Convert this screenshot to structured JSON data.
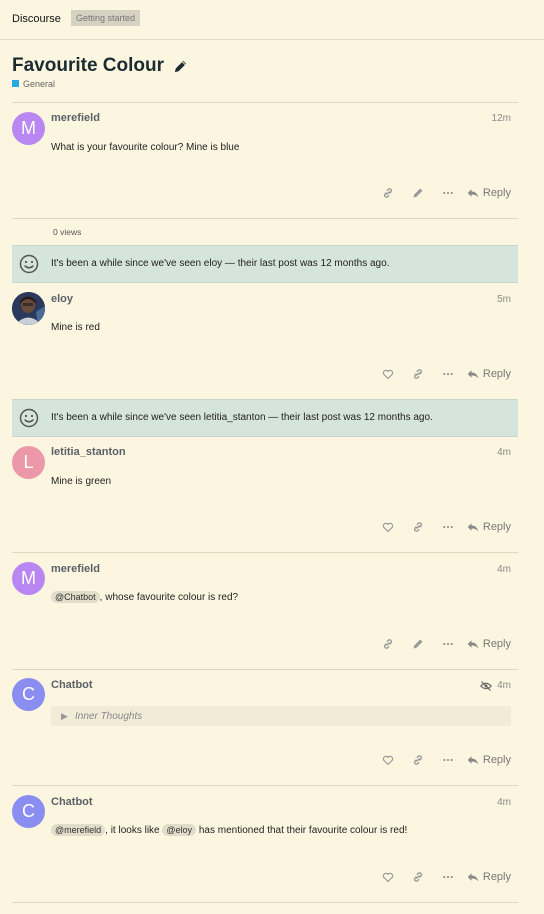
{
  "header": {
    "site_name": "Discourse",
    "tag": "Getting started"
  },
  "topic": {
    "title": "Favourite Colour",
    "category": "General",
    "category_color": "#25aae1",
    "views": "0 views"
  },
  "notices": [
    {
      "text": "It's been a while since we've seen eloy — their last post was 12 months ago."
    },
    {
      "text": "It's been a while since we've seen letitia_stanton — their last post was 12 months ago."
    }
  ],
  "posts": [
    {
      "username": "merefield",
      "avatar_letter": "M",
      "avatar_color": "#b887f2",
      "date": "12m",
      "body": "What is your favourite colour? Mine is blue",
      "reply_label": "Reply"
    },
    {
      "username": "eloy",
      "avatar_letter": "",
      "avatar_color": "#3a4a66",
      "date": "5m",
      "body": "Mine is red",
      "reply_label": "Reply"
    },
    {
      "username": "letitia_stanton",
      "avatar_letter": "L",
      "avatar_color": "#ec98a9",
      "date": "4m",
      "body": "Mine is green",
      "reply_label": "Reply"
    },
    {
      "username": "merefield",
      "avatar_letter": "M",
      "avatar_color": "#b887f2",
      "date": "4m",
      "mention": "@Chatbot",
      "body_rest": ", whose favourite colour is red?",
      "reply_label": "Reply"
    },
    {
      "username": "Chatbot",
      "avatar_letter": "C",
      "avatar_color": "#8a8ef0",
      "date": "4m",
      "details_label": "Inner Thoughts",
      "reply_label": "Reply"
    },
    {
      "username": "Chatbot",
      "avatar_letter": "C",
      "avatar_color": "#8a8ef0",
      "date": "4m",
      "mention1": "@merefield",
      "text_mid": ", it looks like ",
      "mention2": "@eloy",
      "text_end": " has mentioned that their favourite colour is red!",
      "reply_label": "Reply"
    }
  ]
}
